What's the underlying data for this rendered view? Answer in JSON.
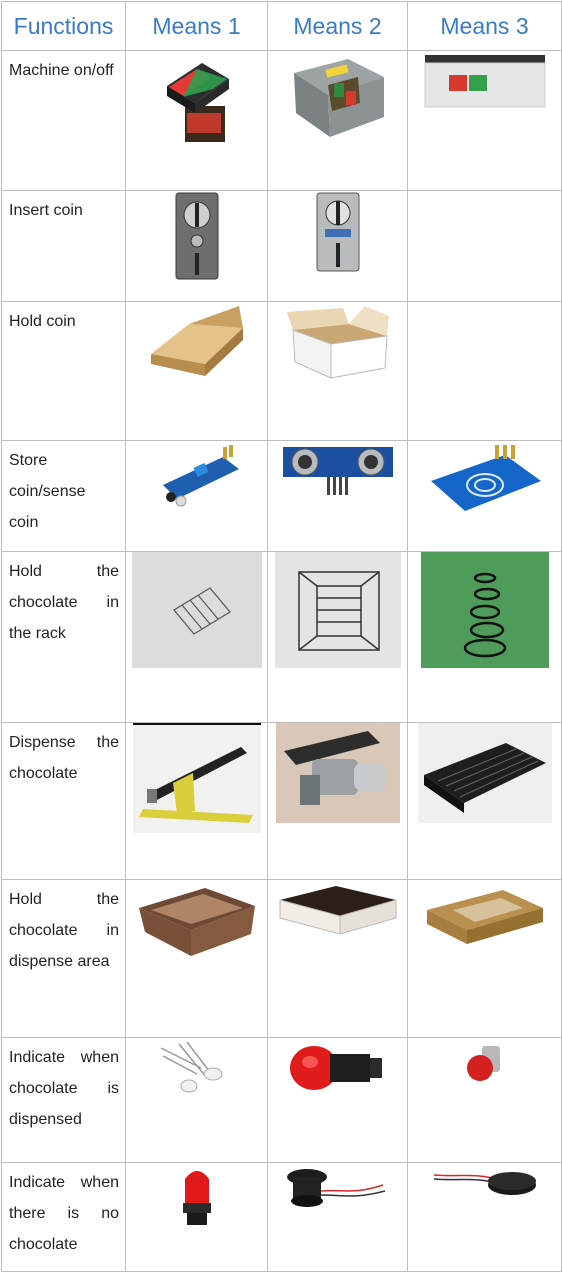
{
  "headers": [
    "Functions",
    "Means 1",
    "Means 2",
    "Means 3"
  ],
  "rows": [
    {
      "function": "Machine on/off",
      "means": [
        "red-green-pushbutton-icon",
        "gray-switch-box-icon",
        "white-switch-panel-icon"
      ]
    },
    {
      "function": "Insert coin",
      "means": [
        "coin-slot-icon",
        "coin-acceptor-icon",
        ""
      ]
    },
    {
      "function": "Hold coin",
      "means": [
        "cardboard-tray-icon",
        "open-box-icon",
        ""
      ]
    },
    {
      "function": "Store coin/sense coin",
      "means": [
        "ir-sensor-module-icon",
        "ultrasonic-sensor-icon",
        "touch-sensor-icon"
      ]
    },
    {
      "function": "Hold the chocolate in the rack",
      "means": [
        "rack-sketch-icon",
        "rack-drawing-icon",
        "spring-coil-icon"
      ]
    },
    {
      "function": "Dispense the chocolate",
      "means": [
        "conveyor-model-icon",
        "gear-motor-icon",
        "dispenser-tray-icon"
      ]
    },
    {
      "function": "Hold the chocolate in dispense area",
      "means": [
        "woven-basket-icon",
        "serving-tray-icon",
        "kraft-box-icon"
      ]
    },
    {
      "function": "Indicate when chocolate is dispensed",
      "means": [
        "led-icon",
        "red-indicator-lamp-icon",
        "small-red-lamp-icon"
      ]
    },
    {
      "function": "Indicate when there is no chocolate",
      "means": [
        "red-beacon-icon",
        "piezo-buzzer-wired-icon",
        "flat-buzzer-icon"
      ]
    }
  ],
  "colors": {
    "header_text": "#3a7bc8",
    "border": "#bdbdbd"
  }
}
